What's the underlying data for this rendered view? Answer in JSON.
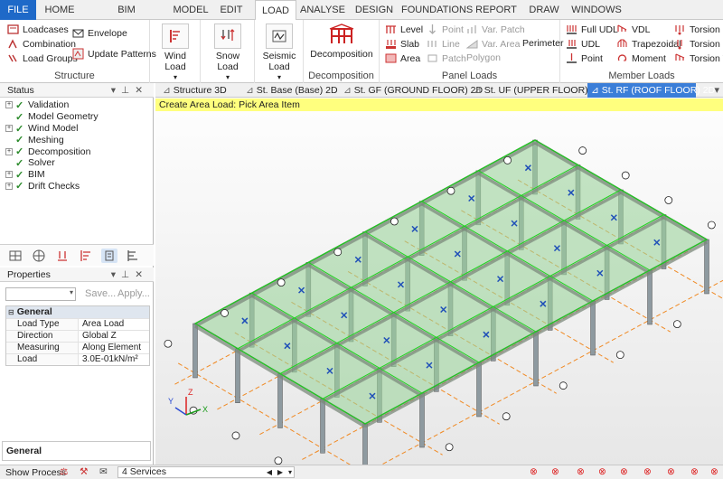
{
  "menu_tabs": [
    "FILE",
    "HOME",
    "BIM INTEGRATION",
    "MODEL",
    "EDIT",
    "LOAD",
    "ANALYSE",
    "DESIGN",
    "FOUNDATIONS",
    "REPORT",
    "DRAW",
    "WINDOWS"
  ],
  "ribbon": {
    "structure": {
      "loadcases": "Loadcases",
      "combination": "Combination",
      "load_groups": "Load Groups",
      "envelope": "Envelope",
      "update_patterns": "Update Patterns",
      "label": "Structure"
    },
    "wind_load": "Wind Load",
    "snow_load": "Snow Load",
    "seismic_load_1": "Seismic",
    "seismic_load_2": "Load",
    "decomposition": {
      "button": "Decomposition",
      "label": "Decomposition"
    },
    "panel_loads": {
      "level": "Level",
      "slab": "Slab",
      "area": "Area",
      "point": "Point",
      "line": "Line",
      "patch": "Patch",
      "var_patch": "Var. Patch",
      "var_area": "Var. Area",
      "polygon": "Polygon",
      "perimeter": "Perimeter",
      "label": "Panel Loads"
    },
    "member_loads": {
      "full_udl": "Full UDL",
      "udl": "UDL",
      "point": "Point",
      "vdl": "VDL",
      "trapezoidal": "Trapezoidal",
      "moment": "Moment",
      "torsion_fu": "Torsion Fu",
      "torsion_u": "Torsion U",
      "torsion_vdl": "Torsion VDL",
      "label": "Member Loads"
    }
  },
  "status_panel": {
    "title": "Status",
    "items": [
      "Validation",
      "Model Geometry",
      "Wind Model",
      "Meshing",
      "Decomposition",
      "Solver",
      "BIM",
      "Drift Checks"
    ]
  },
  "properties_panel": {
    "title": "Properties",
    "save": "Save...",
    "apply": "Apply...",
    "group": "General",
    "rows": [
      {
        "key": "Load Type",
        "value": "Area Load"
      },
      {
        "key": "Direction",
        "value": "Global Z"
      },
      {
        "key": "Measuring",
        "value": "Along Element"
      },
      {
        "key": "Load",
        "value": "3.0E-01kN/m²"
      }
    ],
    "footer": "General"
  },
  "doc_tabs": [
    "Structure 3D",
    "St. Base (Base) 2D",
    "St. GF (GROUND FLOOR) 2D",
    "St. UF (UPPER FLOOR) 2D",
    "St. RF (ROOF FLOOR) 2D"
  ],
  "prompt": "Create Area Load: Pick Area Item",
  "axes": {
    "x": "X",
    "y": "Y",
    "z": "Z"
  },
  "statusbar": {
    "show_process": "Show Process",
    "services": "4 Services"
  },
  "colors": {
    "file_tab": "#1e69c8",
    "active_doc_tab": "#3b7ed8",
    "prompt_bg": "#ffff7e",
    "slab": "#9cd49c",
    "grid_lines": "#1fd21f",
    "gridline_orange": "#f08a24"
  }
}
